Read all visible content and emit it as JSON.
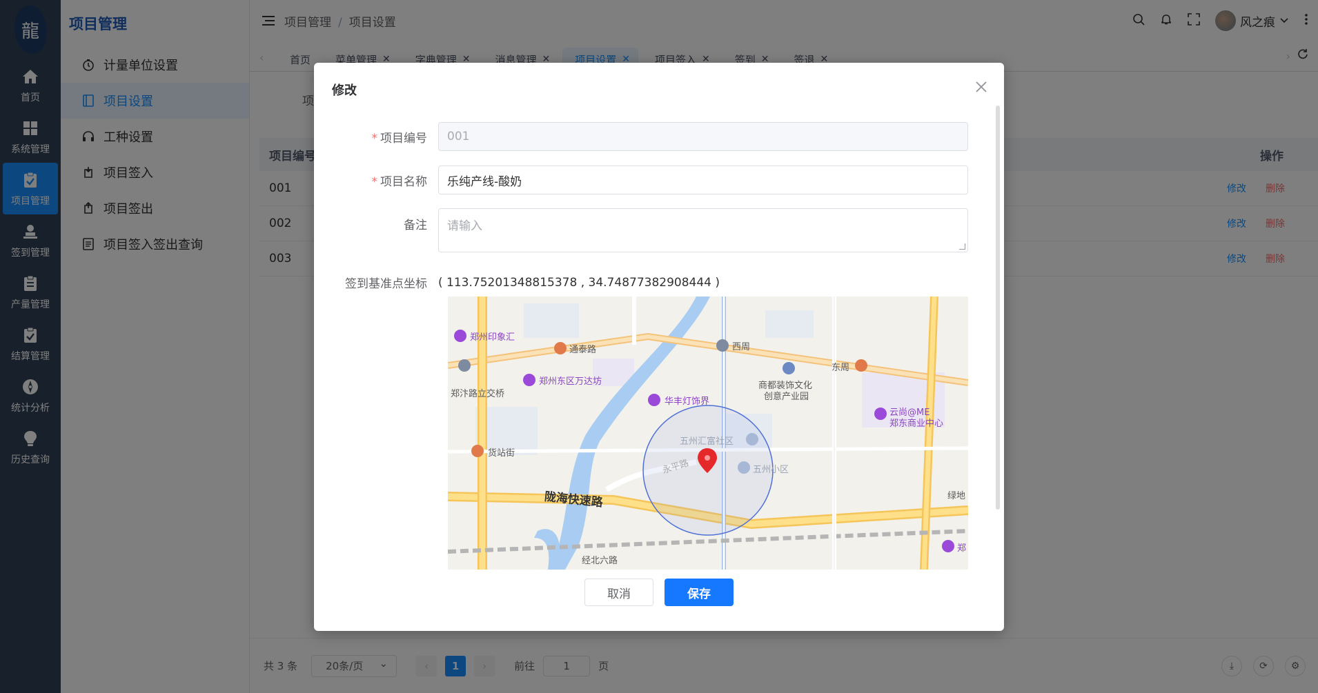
{
  "rail": {
    "items": [
      {
        "label": "首页",
        "icon": "home-icon"
      },
      {
        "label": "系统管理",
        "icon": "grid-icon"
      },
      {
        "label": "项目管理",
        "icon": "clipboard-check-icon"
      },
      {
        "label": "签到管理",
        "icon": "user-stamp-icon"
      },
      {
        "label": "产量管理",
        "icon": "clipboard-list-icon"
      },
      {
        "label": "结算管理",
        "icon": "clipboard-check-icon"
      },
      {
        "label": "统计分析",
        "icon": "compass-icon"
      },
      {
        "label": "历史查询",
        "icon": "bulb-icon"
      }
    ]
  },
  "sidebar": {
    "title": "项目管理",
    "items": [
      {
        "label": "计量单位设置",
        "icon": "stopwatch-icon"
      },
      {
        "label": "项目设置",
        "icon": "panel-icon"
      },
      {
        "label": "工种设置",
        "icon": "headset-icon"
      },
      {
        "label": "项目签入",
        "icon": "sign-in-icon"
      },
      {
        "label": "项目签出",
        "icon": "sign-out-icon"
      },
      {
        "label": "项目签入签出查询",
        "icon": "document-icon"
      }
    ]
  },
  "header": {
    "breadcrumb": [
      "项目管理",
      "项目设置"
    ],
    "username": "风之痕"
  },
  "tabs": [
    {
      "label": "首页"
    },
    {
      "label": "菜单管理"
    },
    {
      "label": "字典管理"
    },
    {
      "label": "消息管理"
    },
    {
      "label": "项目设置"
    },
    {
      "label": "项目签入"
    },
    {
      "label": "签到"
    },
    {
      "label": "签退"
    }
  ],
  "page": {
    "filter_label": "项",
    "table": {
      "col_code": "项目编号",
      "col_ops": "操作",
      "rows": [
        {
          "code": "001",
          "edit": "修改",
          "delete": "删除"
        },
        {
          "code": "002",
          "edit": "修改",
          "delete": "删除"
        },
        {
          "code": "003",
          "edit": "修改",
          "delete": "删除"
        }
      ]
    },
    "pager": {
      "total": "共 3 条",
      "page_size": "20条/页",
      "current": "1",
      "goto_prefix": "前往",
      "goto_value": "1",
      "goto_suffix": "页"
    }
  },
  "dialog": {
    "title": "修改",
    "fields": {
      "code_label": "项目编号",
      "code_value": "001",
      "name_label": "项目名称",
      "name_value": "乐纯产线-酸奶",
      "remark_label": "备注",
      "remark_placeholder": "请输入",
      "coord_label": "签到基准点坐标",
      "coord_value": "( 113.75201348815378 , 34.74877382908444 )"
    },
    "map": {
      "labels": {
        "p1": "郑州印象汇",
        "p2": "通泰路",
        "p3": "西周",
        "p4": "东周",
        "p5": "郑州东区万达坊",
        "p6": "郑汴路立交桥",
        "p7": "华丰灯饰界",
        "p8a": "商都装饰文化",
        "p8b": "创意产业园",
        "p9a": "云尚@ME",
        "p9b": "郑东商业中心",
        "p10": "五州汇富社区",
        "p11": "五州小区",
        "p12": "永平路",
        "p13": "货站街",
        "p14": "陇海快速路",
        "p15": "绿地",
        "p16": "经北六路",
        "p17": "郑"
      }
    },
    "cancel": "取消",
    "save": "保存"
  },
  "colors": {
    "primary": "#1677ff",
    "rail_bg": "#304156",
    "danger": "#f56c6c"
  }
}
